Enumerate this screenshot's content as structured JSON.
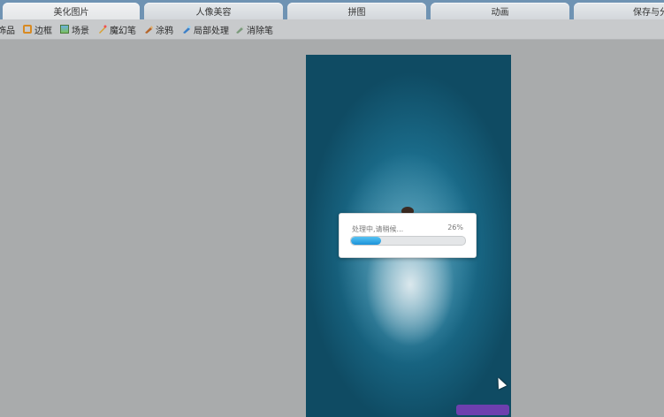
{
  "tabs": [
    {
      "label": "美化图片",
      "active": true
    },
    {
      "label": "人像美容",
      "active": false
    },
    {
      "label": "拼图",
      "active": false
    },
    {
      "label": "动画",
      "active": false
    },
    {
      "label": "保存与分",
      "active": false
    }
  ],
  "toolbar": {
    "items": [
      {
        "label": "饰品",
        "icon": "accessory-icon"
      },
      {
        "label": "边框",
        "icon": "frame-icon"
      },
      {
        "label": "场景",
        "icon": "scene-icon"
      },
      {
        "label": "魔幻笔",
        "icon": "magic-pen-icon"
      },
      {
        "label": "涂鸦",
        "icon": "doodle-icon"
      },
      {
        "label": "局部处理",
        "icon": "partial-edit-icon"
      },
      {
        "label": "消除笔",
        "icon": "eraser-pen-icon"
      }
    ]
  },
  "progress_dialog": {
    "message": "处理中,请稍候...",
    "percent_text": "26%",
    "progress": 0.26
  },
  "colors": {
    "accent": "#1c92d8",
    "tabbar": "#6f93b3",
    "background": "#a9abac"
  }
}
